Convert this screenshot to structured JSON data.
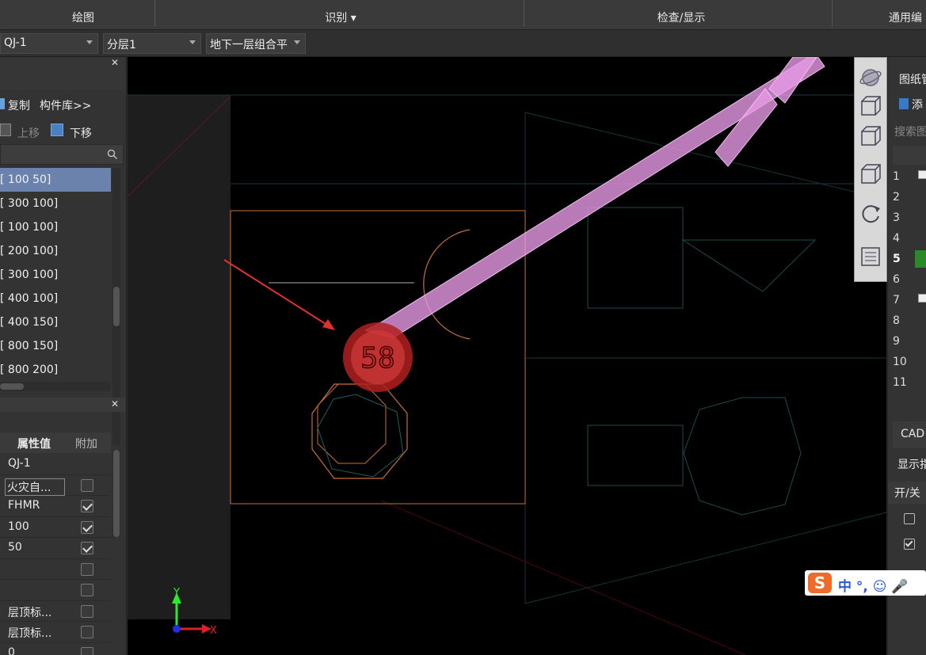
{
  "ribbon": {
    "groups": [
      "绘图",
      "识别 ▾",
      "检查/显示",
      "通用编"
    ]
  },
  "toolbar": {
    "component_select": "QJ-1",
    "layer_select": "分层1",
    "floor_select": "地下一层组合平"
  },
  "left_panel": {
    "copy_label": "复制",
    "library_label": "构件库>>",
    "move_up_label": "上移",
    "move_down_label": "下移",
    "list_items": [
      "[ 100 50]",
      "[ 300 100]",
      "[ 100 100]",
      "[ 200 100]",
      "[ 300 100]",
      "[ 400 100]",
      "[ 400 150]",
      "[ 800 150]",
      "[ 800 200]"
    ],
    "props_header": {
      "value_col": "属性值",
      "extra_col": "附加"
    },
    "props": [
      {
        "value": "QJ-1",
        "checkbox": null
      },
      {
        "value": "火灾自...",
        "checkbox": false
      },
      {
        "value": "FHMR",
        "checkbox": true
      },
      {
        "value": "100",
        "checkbox": true
      },
      {
        "value": "50",
        "checkbox": true
      },
      {
        "value": "",
        "checkbox": false
      },
      {
        "value": "",
        "checkbox": false
      },
      {
        "value": "层顶标...",
        "checkbox": false
      },
      {
        "value": "层顶标...",
        "checkbox": false
      },
      {
        "value": "0",
        "checkbox": false
      }
    ]
  },
  "canvas": {
    "marker_label": "58",
    "axis_y": "Y",
    "axis_x": "X"
  },
  "right_panel": {
    "title": "图纸管",
    "add_label": "添",
    "search_placeholder": "搜索图",
    "rows": [
      "1",
      "2",
      "3",
      "4",
      "5",
      "6",
      "7",
      "8",
      "9",
      "10",
      "11"
    ],
    "cad_label": "CAD",
    "display_label": "显示指",
    "onoff_label": "开/关"
  },
  "ime": {
    "label": "中 °, ☺ 🎤"
  },
  "colors": {
    "accent_selected": "#6b82ad",
    "cad_orange": "#c8703a",
    "pipe_pink": "#e79ae6",
    "marker_red": "#d23a3a",
    "arrow_red": "#e03030"
  }
}
